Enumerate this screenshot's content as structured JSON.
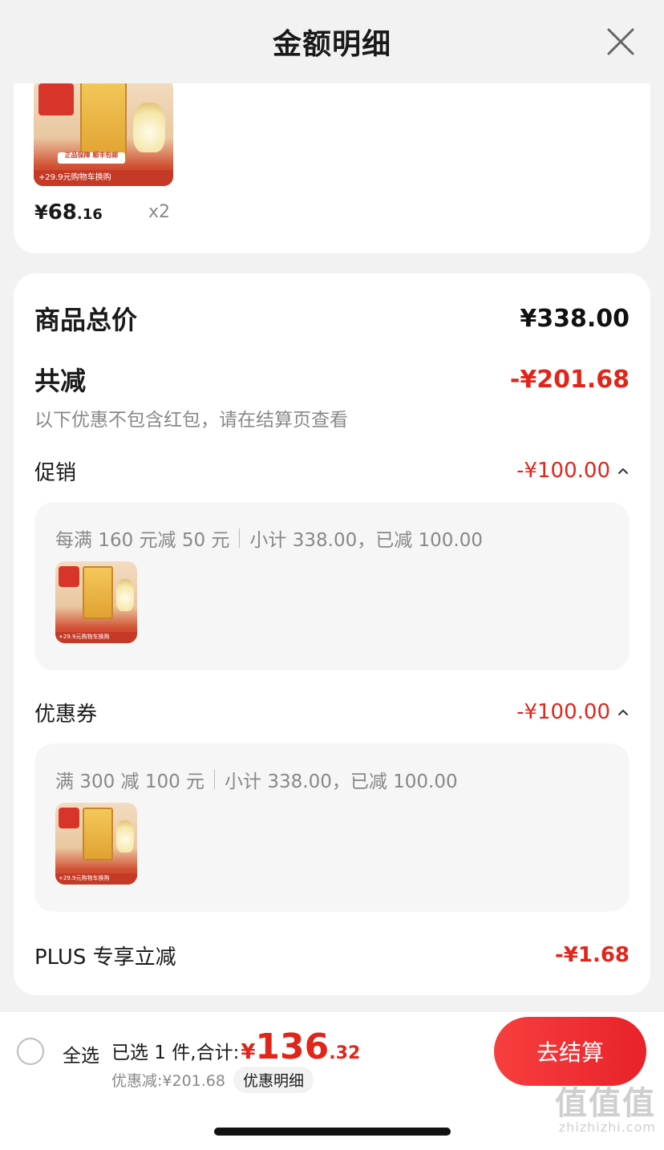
{
  "header": {
    "title": "金额明细"
  },
  "product": {
    "price_yen": "¥",
    "price_int": "68",
    "price_dec": ".16",
    "qty": "x2",
    "thumb_strip_text": "+29.9元购物车换购",
    "thumb_badge_text": "正品保障 顺丰包邮"
  },
  "summary": {
    "goods_total_label": "商品总价",
    "goods_total_value": "¥338.00",
    "reduce_label": "共减",
    "reduce_value": "-¥201.68",
    "reduce_note": "以下优惠不包含红包，请在结算页查看"
  },
  "promo": {
    "label": "促销",
    "value": "-¥100.00",
    "rule": "每满 160 元减 50 元",
    "detail": "小计 338.00，已减 100.00"
  },
  "coupon": {
    "label": "优惠券",
    "value": "-¥100.00",
    "rule": "满 300 减 100 元",
    "detail": "小计 338.00，已减 100.00"
  },
  "plus": {
    "label": "PLUS 专享立减",
    "value": "-¥1.68"
  },
  "bottom": {
    "select_all": "全选",
    "selected_label": "已选 1 件,合计:",
    "total_yen": "¥",
    "total_int": "136",
    "total_dec": ".32",
    "discount_label": "优惠减:¥201.68",
    "discount_detail_btn": "优惠明细",
    "checkout": "去结算"
  },
  "watermark": {
    "logo": "值值值",
    "url": "zhizhizhi.com"
  },
  "colors": {
    "accent_red": "#e1251b",
    "checkout_gradient_start": "#f73f3f",
    "background": "#f2f2f2"
  },
  "icons": {
    "close": "close-icon",
    "expand": "chevron-up-icon",
    "radio": "radio-unchecked-icon"
  }
}
